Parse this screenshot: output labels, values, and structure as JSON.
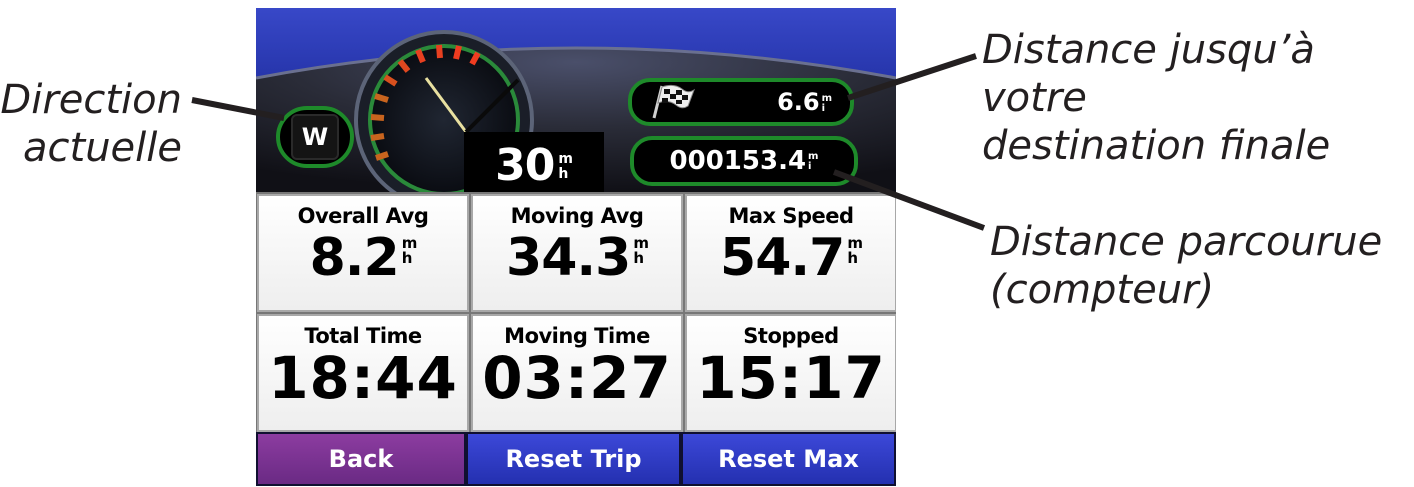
{
  "callouts": {
    "direction_line1": "Direction",
    "direction_line2": "actuelle",
    "destination_line1": "Distance jusqu’à votre",
    "destination_line2": "destination finale",
    "odometer_line1": "Distance parcourue",
    "odometer_line2": "(compteur)"
  },
  "dashboard": {
    "heading": "W",
    "speed": "30",
    "speed_unit_top": "m",
    "speed_unit_bottom": "h",
    "distance_to_destination": "6.6",
    "distance_unit_top": "m",
    "distance_unit_bottom": "i",
    "odometer": "000153.4",
    "odometer_unit_top": "m",
    "odometer_unit_bottom": "i",
    "icons": [
      "compass-badge",
      "checkered-flag-icon",
      "speedometer-gauge"
    ]
  },
  "stats": [
    {
      "label": "Overall Avg",
      "value": "8.2",
      "unit_top": "m",
      "unit_bottom": "h"
    },
    {
      "label": "Moving Avg",
      "value": "34.3",
      "unit_top": "m",
      "unit_bottom": "h"
    },
    {
      "label": "Max Speed",
      "value": "54.7",
      "unit_top": "m",
      "unit_bottom": "h"
    },
    {
      "label": "Total Time",
      "value": "18:44"
    },
    {
      "label": "Moving Time",
      "value": "03:27"
    },
    {
      "label": "Stopped",
      "value": "15:17"
    }
  ],
  "buttons": {
    "back": "Back",
    "reset_trip": "Reset Trip",
    "reset_max": "Reset Max"
  },
  "colors": {
    "back_button": "#7a3492",
    "reset_buttons": "#2f3bc6",
    "pill_border": "#1e8a2a",
    "dashboard_blue": "#1c2a9a"
  }
}
